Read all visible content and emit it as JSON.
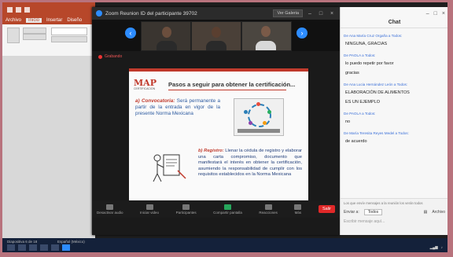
{
  "zoom": {
    "title": "Zoom Reunion ID del participante 39702",
    "view_button": "Ver Galeria",
    "rec_label": "Grabando"
  },
  "slide": {
    "logo": "MAP",
    "logo_sub": "CERTIFICACION",
    "title": "Pasos a seguir para obtener la certificación...",
    "step_a_key": "a) Convocatoria:",
    "step_a_text": "Será permanente a partir de la entrada en vigor de la presente Norma Mexicana",
    "step_b_key": "b) Registro:",
    "step_b_text": "Llenar la cédula de registro y elaborar una carta compromiso, documento que manifestará el interés en obtener la certificación, asumiendo la responsabilidad de cumplir con los requisitos establecidos en la Norma Mexicana"
  },
  "controls": {
    "items": [
      {
        "label": "Desactivar audio"
      },
      {
        "label": "Iniciar video"
      },
      {
        "label": "Participantes"
      },
      {
        "label": "Compartir pantalla"
      },
      {
        "label": "Reacciones"
      },
      {
        "label": "Más"
      }
    ],
    "leave": "Salir"
  },
  "chat": {
    "title": "Chat",
    "messages": [
      {
        "from": "De Ana María Cruz Orgaña a Todos:",
        "texts": [
          "NINGUNA, GRACIAS"
        ]
      },
      {
        "from": "De PAOLA a Todos:",
        "texts": [
          "lo puedo repetir por favor",
          "gracias"
        ]
      },
      {
        "from": "De Ana Lucia Hernández León a Todos:",
        "texts": [
          "ELABORACIÓN DE ALIMENTOS",
          "ES UN EJEMPLO"
        ]
      },
      {
        "from": "De PAOLA a Todos:",
        "texts": [
          "no"
        ]
      },
      {
        "from": "De María Teresita Reyes Medel a Todos:",
        "texts": [
          "de acuerdo"
        ]
      }
    ],
    "foot_note": "Los que envíe mensajes a la reunión los verán todos",
    "to_label": "Enviar a:",
    "to_value": "Todos",
    "file_label": "Archivo",
    "input_placeholder": "Escribir mensaje aquí..."
  },
  "ppt": {
    "tabs": [
      "Archivo",
      "Inicio",
      "Insertar",
      "Diseño"
    ],
    "active_tab": "Inicio"
  },
  "taskbar": {
    "status_left": "Diapositiva 6 de 18",
    "lang": "Español (México)"
  }
}
